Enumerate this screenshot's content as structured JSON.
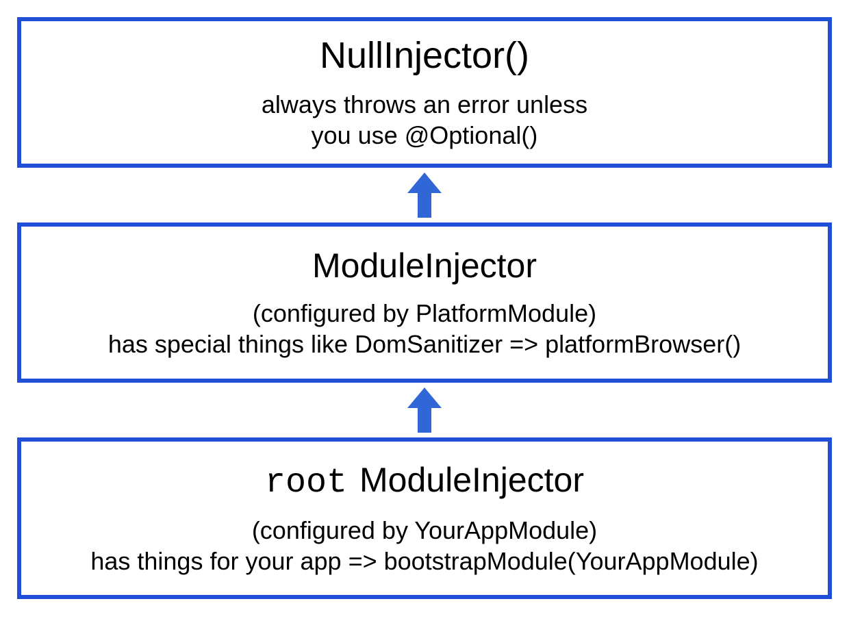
{
  "colors": {
    "border": "#1f4fd6",
    "arrow": "#3166d6",
    "text": "#000000",
    "background": "#ffffff"
  },
  "boxes": [
    {
      "title": "NullInjector()",
      "subtitle_line1": "always throws an error unless",
      "subtitle_line2": "you use @Optional()"
    },
    {
      "title": "ModuleInjector",
      "subtitle_line1": "(configured by PlatformModule)",
      "subtitle_line2": "has special things like DomSanitizer => platformBrowser()"
    },
    {
      "title_code": "root",
      "title_plain": "ModuleInjector",
      "subtitle_line1": "(configured by YourAppModule)",
      "subtitle_line2": "has things for your app  => bootstrapModule(YourAppModule)"
    }
  ]
}
